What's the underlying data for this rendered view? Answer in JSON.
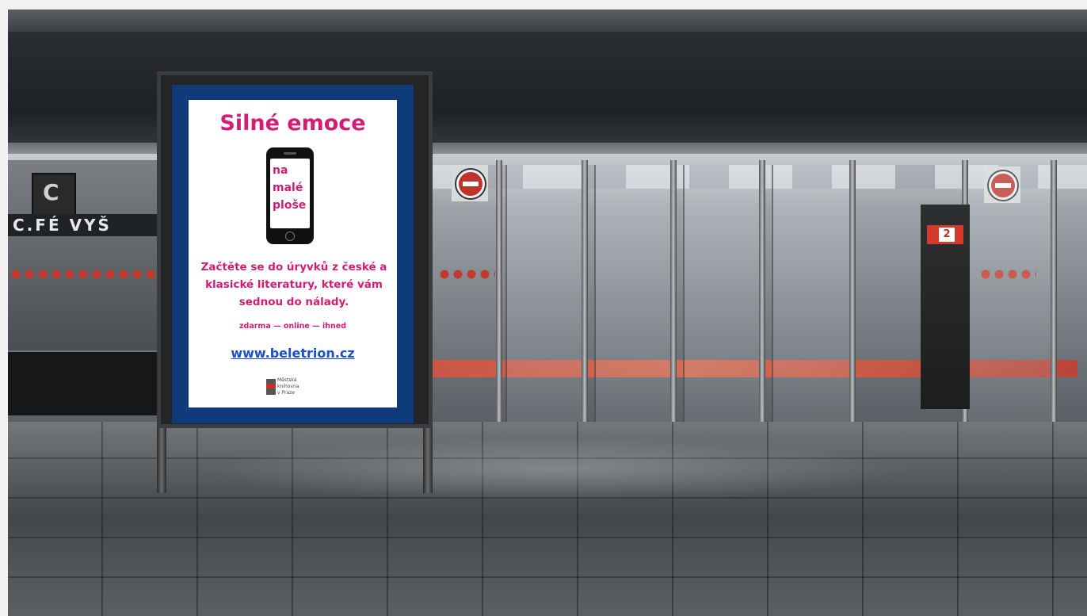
{
  "poster": {
    "title": "Silné emoce",
    "phone_text": [
      "na",
      "malé",
      "ploše"
    ],
    "body": "Začtěte se do úryvků z české a klasické literatury, které vám sednou do nálady.",
    "tagline": "zdarma — online — ihned",
    "url": "www.beletrion.cz",
    "logo_lines": [
      "Městská",
      "knihovna",
      "v Praze"
    ]
  },
  "scene": {
    "shop_sign": "C.FÉ VYŠ",
    "shop_box_letter": "C",
    "exit_number": "2"
  },
  "colors": {
    "poster_accent": "#d31c75",
    "poster_frame": "#0f3b7a",
    "url_link": "#1d4fc9"
  }
}
